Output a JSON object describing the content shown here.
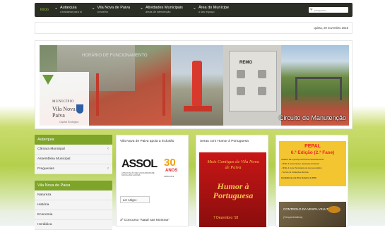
{
  "topnav": {
    "home": "Início",
    "items": [
      {
        "label": "Autarquia",
        "sub": "a trabalhar para si"
      },
      {
        "label": "Vila Nova de Paiva",
        "sub": "concelho"
      },
      {
        "label": "Atividades Municipais",
        "sub": "áreas de intervenção"
      },
      {
        "label": "Área do Munícipe",
        "sub": "o seu espaço"
      }
    ],
    "search_placeholder": "pesquisa..."
  },
  "datebar": {
    "date": "quinta, 29 novembro 2018"
  },
  "banner": {
    "logo_small": "MUNICÍPIO",
    "logo_name": "Vila Nova de Paiva",
    "logo_tagline": "Capital Ecológica",
    "sign_text": "HORÁRIO DE FUNCIONAMENTO",
    "panel_title": "REMO",
    "caption": "Circuito de Manutenção"
  },
  "sidebar": {
    "sections": [
      {
        "title": "Autarquia",
        "items": [
          {
            "label": "Câmara Municipal",
            "chevron": true
          },
          {
            "label": "Assembleia Municipal",
            "chevron": false
          },
          {
            "label": "Freguesias",
            "chevron": true
          }
        ]
      },
      {
        "title": "Vila Nova de Paiva",
        "items": [
          {
            "label": "Natureza",
            "chevron": false
          },
          {
            "label": "História",
            "chevron": false
          },
          {
            "label": "Economia",
            "chevron": false
          },
          {
            "label": "Heráldica",
            "chevron": false
          }
        ]
      }
    ]
  },
  "news": [
    {
      "title": "Vila Nova de Paiva apoia a inclusão",
      "logo_text": "ASSOL",
      "logo_small": "ASSOCIAÇÃO DE SOLIDARIEDADE SOCIAL DE LAFÕES",
      "anniversary": "30",
      "anniversary_label": "ANOS",
      "anniversary_years": "1989-2019",
      "button": "Ler Artigo",
      "next_title": "3º Concurso \"Natal nas Montras\""
    },
    {
      "title": "Serau com Humor à Portuguesa",
      "poster_line1": "Mais Cantigas de Vila Nova de Paiva",
      "poster_line2": "Humor à Portuguesa",
      "poster_date": "7 Dezembro '18"
    },
    {
      "pepal_title": "PEPAL",
      "pepal_subtitle": "6.ª Edição (2.ª Fase)",
      "pepal_lines": [
        "OFERTA DE 2 (DOIS) ESTÁGIOS PROFISSIONAIS",
        "- NÍVEL 6 (Licenciatura) - Educação Ambiental",
        "- NÍVEL 4 (curso Tecnológico de nível secundário)",
        "- Técnico de Instalações Elétricas",
        "Candidaturas até 28 de Outubro de 2018"
      ],
      "vespa_title": "CONTROLO DA VESPA VELUTINA",
      "vespa_sub": "(Vespa Asiática)"
    }
  ],
  "colors": {
    "nav_bg": "#2b2e25",
    "accent_green": "#7ea42a",
    "pepal_yellow": "#f3c531",
    "poster_red": "#c81616"
  }
}
